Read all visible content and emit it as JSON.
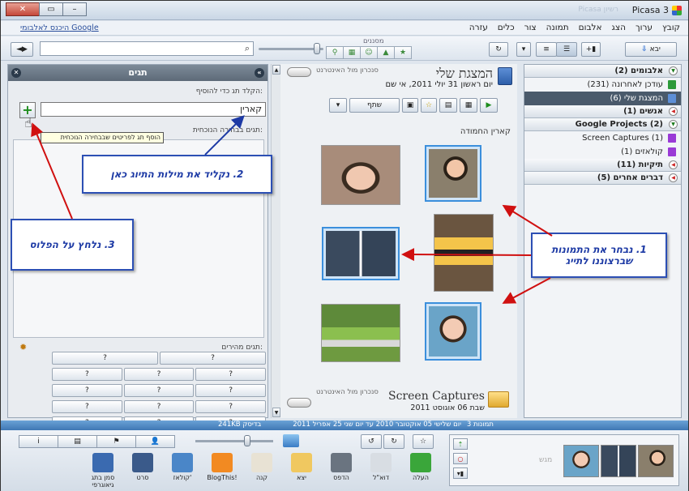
{
  "window": {
    "title": "Picasa 3",
    "ghost_text": "Picasa רשיון",
    "close_label": "✕",
    "restore_label": "▭",
    "minimize_label": "–"
  },
  "menu": [
    "קובץ",
    "ערוך",
    "הצג",
    "אלבום",
    "תמונה",
    "צור",
    "כלים",
    "עזרה"
  ],
  "signin": "היכנס לאלבומי Google",
  "toolbar": {
    "import_label": "יבא",
    "filter_label": "מסננים",
    "search_placeholder": ""
  },
  "tags_panel": {
    "title": "תגים",
    "type_label": "הקלד תג כדי להוסיף:",
    "input_value": "קארין",
    "plus_label": "+",
    "tooltip": "הוסף תג לפריטים שבבחירה הנוכחית",
    "current_label": "תגים בבחירה הנוכחית:",
    "quick_label": "תגים מהירים:",
    "quick_rows": [
      [
        "?",
        "?"
      ],
      [
        "?",
        "?",
        "?"
      ],
      [
        "?",
        "?",
        "?"
      ],
      [
        "?",
        "?",
        "?"
      ],
      [
        "?",
        "?",
        "?"
      ]
    ]
  },
  "center": {
    "sync_label": "סנכרון מול האינטרנט",
    "album_title": "המצגת שלי",
    "album_date": "יום ראשון 31 יולי 2011, אי שם",
    "share_label": "שתף",
    "caption": "קארין החמודה",
    "sc_title": "Screen Captures",
    "sc_date": "שבת 06 אוגוסט 2011",
    "sync_label_2": "סנכרון מול האינטרנט"
  },
  "sidebar": {
    "groups": [
      {
        "label": "אלבומים (2)",
        "open": true,
        "items": [
          {
            "label": "עודכן לאחרונה (231)",
            "selected": false
          },
          {
            "label": "המצגת שלי (6)",
            "selected": true
          }
        ]
      },
      {
        "label": "אנשים (1)",
        "open": false,
        "items": []
      },
      {
        "label": "Google Projects (2)",
        "open": true,
        "items": [
          {
            "label": "Screen Captures (1)",
            "selected": false
          },
          {
            "label": "קולאזים (1)",
            "selected": false
          }
        ]
      },
      {
        "label": "תיקיות (11)",
        "open": false,
        "items": []
      },
      {
        "label": "דברים אחרים (5)",
        "open": false,
        "items": []
      }
    ]
  },
  "callouts": {
    "step1": "1. נבחר את התמונות שברצוננו לתייג",
    "step2": "2. נקליד את מילות התיוג כאן",
    "step3": "3. נלחץ על הפלוס"
  },
  "status": {
    "count": "3 תמונות",
    "range": "יום שלישי 05 אוקטובר 2010 עד יום שני 25 אפריל 2011",
    "size": "241KB בדיסק"
  },
  "bottom": {
    "tabs": [
      "i",
      "▤",
      "⚑",
      "👤"
    ],
    "tools": [
      "העלה",
      "דוא\"ל",
      "הדפס",
      "יצא",
      "קנה",
      "BlogThis!",
      "קולאז'",
      "סרט",
      "סמן בתג גיאוגרפי"
    ],
    "tray_ghost": "מגש"
  },
  "colors": {
    "accent": "#3b8fdc",
    "callout_border": "#2c4fb4",
    "arrow": "#d01010",
    "status_bar": "#4f86c2"
  }
}
